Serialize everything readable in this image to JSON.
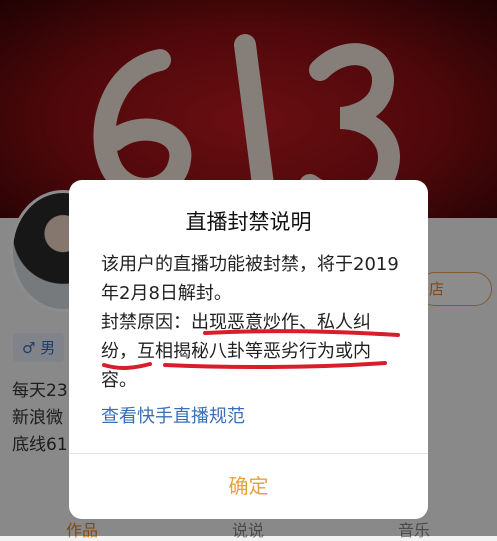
{
  "background": {
    "cover_text": "613",
    "gender_label": "♂ 男",
    "store_button_label": "店",
    "bio_lines": [
      "每天23",
      "新浪微",
      "底线61"
    ],
    "tabs": [
      "作品",
      "说说",
      "音乐"
    ]
  },
  "dialog": {
    "title": "直播封禁说明",
    "paragraph1": "该用户的直播功能被封禁，将于2019年2月8日解封。",
    "reason_label": "封禁原因：",
    "reason_text": "出现恶意炒作、私人纠纷，互相揭秘八卦等恶劣行为或内容。",
    "rules_link": "查看快手直播规范",
    "confirm_button": "确定"
  },
  "colors": {
    "accent": "#e8a23c",
    "link": "#3a6fb6",
    "underline": "#d81e2a"
  }
}
